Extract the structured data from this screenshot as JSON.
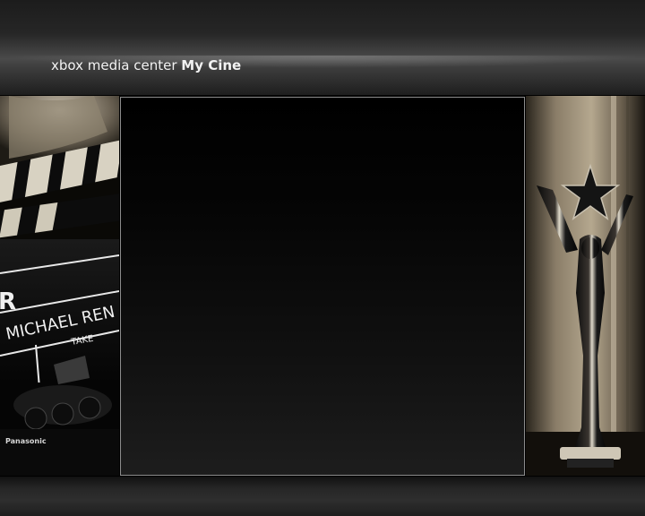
{
  "header": {
    "app_name": "xbox media center",
    "section_title": "My Cine"
  },
  "left_image": {
    "slate_name": "MICHAEL REN",
    "slate_take": "TAKE",
    "slate_letter": "R",
    "camera_brand": "Panasonic"
  },
  "colors": {
    "background": "#000000",
    "header_text": "#f2f2f2",
    "panel_border": "#8c8c8c",
    "sepia_light": "#b5a88f"
  }
}
